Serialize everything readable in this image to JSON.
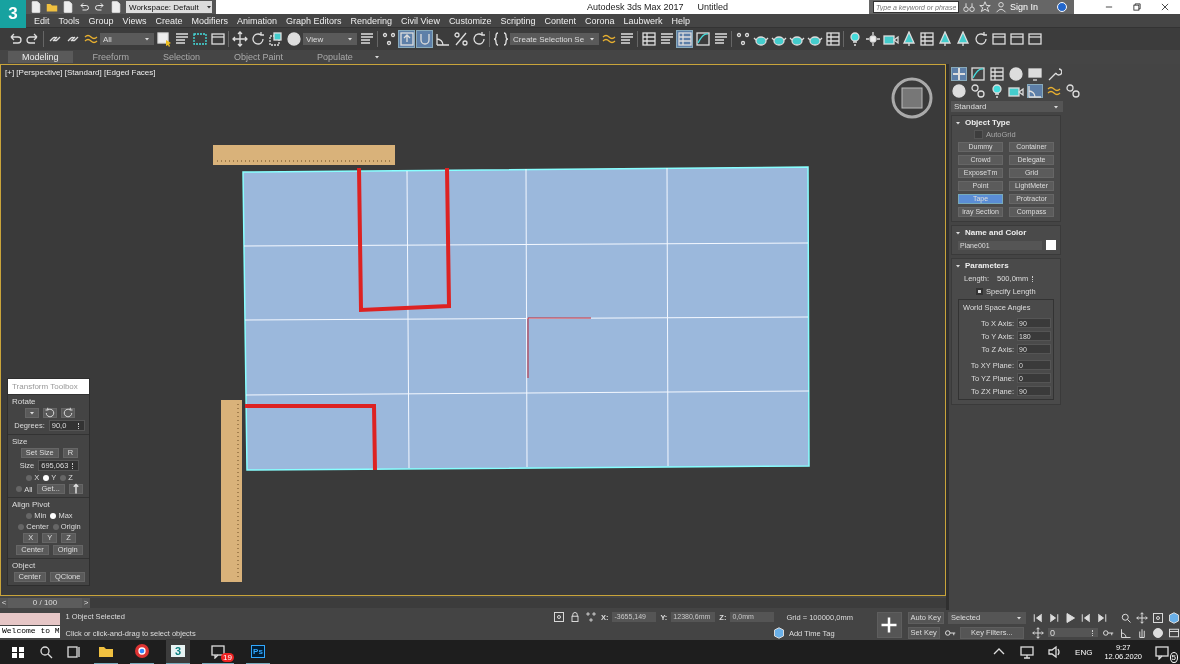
{
  "title_bar": {
    "logo": "3",
    "workspace": "Workspace: Default",
    "title": "Autodesk 3ds Max 2017",
    "document": "Untitled",
    "search": {
      "placeholder": "Type a keyword or phrase"
    },
    "sign_in": "Sign In"
  },
  "menu": [
    "Edit",
    "Tools",
    "Group",
    "Views",
    "Create",
    "Modifiers",
    "Animation",
    "Graph Editors",
    "Rendering",
    "Civil View",
    "Customize",
    "Scripting",
    "Content",
    "Corona",
    "Laubwerk",
    "Help"
  ],
  "main_toolbar": [
    {
      "kind": "button",
      "selected": false
    },
    {
      "kind": "button",
      "selected": false
    },
    {
      "kind": "separator"
    },
    {
      "kind": "button",
      "selected": false
    },
    {
      "kind": "button",
      "selected": false
    },
    {
      "kind": "button",
      "selected": false
    },
    {
      "kind": "dropdown",
      "value": "All"
    },
    {
      "kind": "button",
      "selected": false
    },
    {
      "kind": "button",
      "selected": false
    },
    {
      "kind": "button",
      "selected": false
    },
    {
      "kind": "button",
      "selected": false
    },
    {
      "kind": "separator"
    },
    {
      "kind": "button",
      "selected": false
    },
    {
      "kind": "button",
      "selected": false
    },
    {
      "kind": "button",
      "selected": false
    },
    {
      "kind": "button",
      "selected": false
    },
    {
      "kind": "dropdown",
      "value": "View"
    },
    {
      "kind": "button",
      "selected": false
    },
    {
      "kind": "separator"
    },
    {
      "kind": "button",
      "selected": false
    },
    {
      "kind": "button",
      "selected": true
    },
    {
      "kind": "button",
      "selected": true
    },
    {
      "kind": "button",
      "selected": false
    },
    {
      "kind": "button",
      "selected": false
    },
    {
      "kind": "button",
      "selected": false
    },
    {
      "kind": "separator"
    },
    {
      "kind": "button",
      "selected": false
    },
    {
      "kind": "dropdown",
      "value": "Create Selection Se"
    },
    {
      "kind": "button",
      "selected": false
    },
    {
      "kind": "button",
      "selected": false
    },
    {
      "kind": "separator"
    },
    {
      "kind": "button",
      "selected": false
    },
    {
      "kind": "button",
      "selected": false
    },
    {
      "kind": "button",
      "selected": true
    },
    {
      "kind": "button",
      "selected": false
    },
    {
      "kind": "button",
      "selected": false
    },
    {
      "kind": "separator"
    },
    {
      "kind": "button",
      "selected": false
    },
    {
      "kind": "button",
      "selected": false
    },
    {
      "kind": "button",
      "selected": false
    },
    {
      "kind": "button",
      "selected": false
    },
    {
      "kind": "button",
      "selected": false
    },
    {
      "kind": "button",
      "selected": false
    },
    {
      "kind": "separator"
    },
    {
      "kind": "button",
      "selected": false
    },
    {
      "kind": "button",
      "selected": false
    },
    {
      "kind": "button",
      "selected": false
    },
    {
      "kind": "button",
      "selected": false
    },
    {
      "kind": "button",
      "selected": false
    },
    {
      "kind": "button",
      "selected": false
    },
    {
      "kind": "button",
      "selected": false
    },
    {
      "kind": "button",
      "selected": false
    },
    {
      "kind": "button",
      "selected": false
    },
    {
      "kind": "button",
      "selected": false
    },
    {
      "kind": "button",
      "selected": false
    }
  ],
  "ribbon_tabs": [
    {
      "label": "Modeling",
      "selected": true
    },
    {
      "label": "Freeform",
      "selected": false
    },
    {
      "label": "Selection",
      "selected": false
    },
    {
      "label": "Object Paint",
      "selected": false
    },
    {
      "label": "Populate",
      "selected": false
    }
  ],
  "viewport": {
    "label": "[+] [Perspective] [Standard] [Edged Faces]",
    "active": true
  },
  "transform_toolbox": {
    "title": "Transform Toolbox",
    "sections": [
      {
        "heading": "Rotate",
        "rows": [
          {
            "controls": [
              {
                "kind": "dropdown"
              },
              {
                "kind": "ccw"
              },
              {
                "kind": "cw"
              }
            ]
          },
          {
            "controls": [
              {
                "kind": "spinner",
                "label": "Degrees:",
                "value": "90,0"
              }
            ]
          }
        ]
      },
      {
        "heading": "Size",
        "rows": [
          {
            "controls": [
              {
                "kind": "button",
                "text": "Set Size"
              },
              {
                "kind": "button",
                "text": "R"
              }
            ]
          },
          {
            "controls": [
              {
                "kind": "spinner",
                "label": "Size",
                "value": "695,063"
              }
            ]
          },
          {
            "controls": [
              {
                "kind": "radio",
                "label": "X",
                "selected": false
              },
              {
                "kind": "radio",
                "label": "Y",
                "selected": true
              },
              {
                "kind": "radio",
                "label": "Z",
                "selected": false
              }
            ]
          },
          {
            "controls": [
              {
                "kind": "radio",
                "label": "All",
                "selected": false
              },
              {
                "kind": "button",
                "text": "Get..."
              },
              {
                "kind": "up"
              }
            ]
          }
        ]
      },
      {
        "heading": "Align Pivot",
        "rows": [
          {
            "controls": [
              {
                "kind": "radio",
                "label": "Min",
                "selected": false
              },
              {
                "kind": "radio",
                "label": "Max",
                "selected": true
              }
            ]
          },
          {
            "controls": [
              {
                "kind": "radio",
                "label": "Center",
                "selected": false
              },
              {
                "kind": "radio",
                "label": "Origin",
                "selected": false
              }
            ]
          },
          {
            "controls": [
              {
                "kind": "button",
                "text": "X"
              },
              {
                "kind": "button",
                "text": "Y"
              },
              {
                "kind": "button",
                "text": "Z"
              }
            ]
          },
          {
            "controls": [
              {
                "kind": "button",
                "text": "Center"
              },
              {
                "kind": "button",
                "text": "Origin"
              }
            ]
          }
        ]
      },
      {
        "heading": "Object",
        "rows": [
          {
            "controls": [
              {
                "kind": "button",
                "text": "Center"
              },
              {
                "kind": "button",
                "text": "QClone"
              }
            ]
          }
        ]
      }
    ]
  },
  "command_panel": {
    "tabs": [
      {
        "selected": true
      },
      {
        "selected": false
      },
      {
        "selected": false
      },
      {
        "selected": false
      },
      {
        "selected": false
      },
      {
        "selected": false
      }
    ],
    "subtabs": [
      {
        "selected": false
      },
      {
        "selected": false
      },
      {
        "selected": false
      },
      {
        "selected": false
      },
      {
        "selected": true
      },
      {
        "selected": false
      },
      {
        "selected": false
      }
    ],
    "category": "Standard",
    "object_type": {
      "title": "Object Type",
      "autogrid": {
        "label": "AutoGrid",
        "checked": false,
        "disabled": true
      },
      "buttons": [
        {
          "label": "Dummy",
          "selected": false
        },
        {
          "label": "Container",
          "selected": false
        },
        {
          "label": "Crowd",
          "selected": false
        },
        {
          "label": "Delegate",
          "selected": false
        },
        {
          "label": "ExposeTm",
          "selected": false
        },
        {
          "label": "Grid",
          "selected": false
        },
        {
          "label": "Point",
          "selected": false
        },
        {
          "label": "LightMeter",
          "selected": false
        },
        {
          "label": "Tape",
          "selected": true
        },
        {
          "label": "Protractor",
          "selected": false
        },
        {
          "label": "iray Section",
          "selected": false
        },
        {
          "label": "Compass",
          "selected": false
        }
      ]
    },
    "name_color": {
      "title": "Name and Color",
      "name": "Plane001"
    },
    "parameters": {
      "title": "Parameters",
      "length": {
        "label": "Length:",
        "value": "500,0mm"
      },
      "specify": {
        "label": "Specify Length",
        "checked": true
      },
      "group_title": "World Space Angles",
      "axes": [
        {
          "label": "To X Axis:",
          "value": "90"
        },
        {
          "label": "To Y Axis:",
          "value": "180"
        },
        {
          "label": "To Z Axis:",
          "value": "90"
        }
      ],
      "planes": [
        {
          "label": "To XY Plane:",
          "value": "0"
        },
        {
          "label": "To YZ Plane:",
          "value": "0"
        },
        {
          "label": "To ZX Plane:",
          "value": "90"
        }
      ]
    }
  },
  "timeline": {
    "position": "0 / 100",
    "prev": "<",
    "next": ">",
    "level": 0
  },
  "status": {
    "listener": "Welcome to M",
    "messages": [
      "1 Object Selected",
      "Click or click-and-drag to select objects"
    ],
    "coords": [
      {
        "label": "X:",
        "value": "-3655,149"
      },
      {
        "label": "Y:",
        "value": "12380,6mm"
      },
      {
        "label": "Z:",
        "value": "0,0mm"
      }
    ],
    "grid": "Grid = 100000,0mm",
    "time_tag": "Add Time Tag",
    "auto_key": "Auto Key",
    "set_key": "Set Key",
    "key_mode": "Selected",
    "key_filters": "Key Filters...",
    "frame": "0"
  },
  "taskbar": {
    "apps": [
      {
        "kind": "folder",
        "selected": false
      },
      {
        "kind": "browser",
        "selected": false
      },
      {
        "kind": "max",
        "label": "3",
        "selected": true
      },
      {
        "kind": "chat",
        "badge": "19",
        "selected": false
      },
      {
        "kind": "photoshop",
        "label": "Ps",
        "selected": false
      }
    ],
    "language": "ENG",
    "time": "9:27",
    "date": "12.06.2020",
    "notifications": "5"
  }
}
